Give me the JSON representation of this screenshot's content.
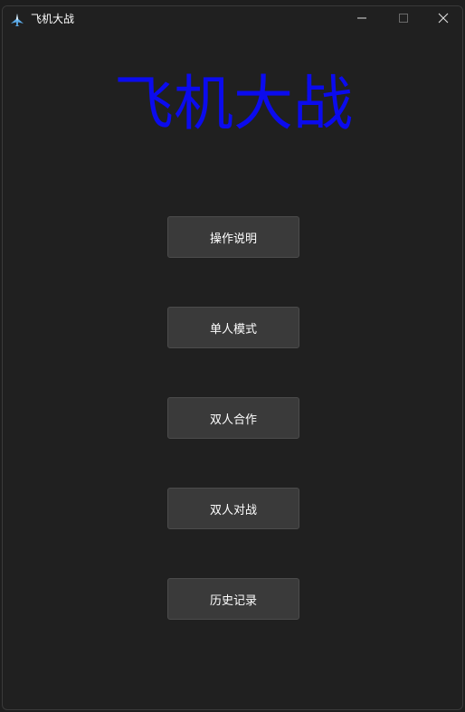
{
  "window": {
    "title": "飞机大战",
    "icon": "plane-app-icon",
    "controls": [
      "minimize-icon",
      "maximize-icon",
      "close-icon"
    ]
  },
  "main": {
    "game_title": "飞机大战",
    "title_color": "#0b0bee",
    "buttons": [
      {
        "label": "操作说明"
      },
      {
        "label": "单人模式"
      },
      {
        "label": "双人合作"
      },
      {
        "label": "双人对战"
      },
      {
        "label": "历史记录"
      }
    ]
  }
}
